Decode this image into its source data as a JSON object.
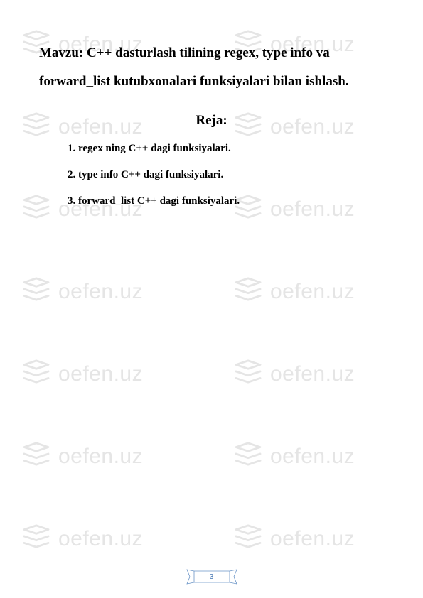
{
  "watermark": {
    "text": "oefen.uz"
  },
  "content": {
    "title_label": "Mavzu:",
    "title_body": " C++ dasturlash tilining  regex,  type info va forward_list kutubxonalari funksiyalari bilan ishlash.",
    "reja_heading": "Reja:",
    "items": [
      "1. regex ning C++ dagi funksiyalari.",
      "2. type info C++ dagi funksiyalari.",
      "3. forward_list  C++ dagi funksiyalari."
    ]
  },
  "page_number": "3"
}
